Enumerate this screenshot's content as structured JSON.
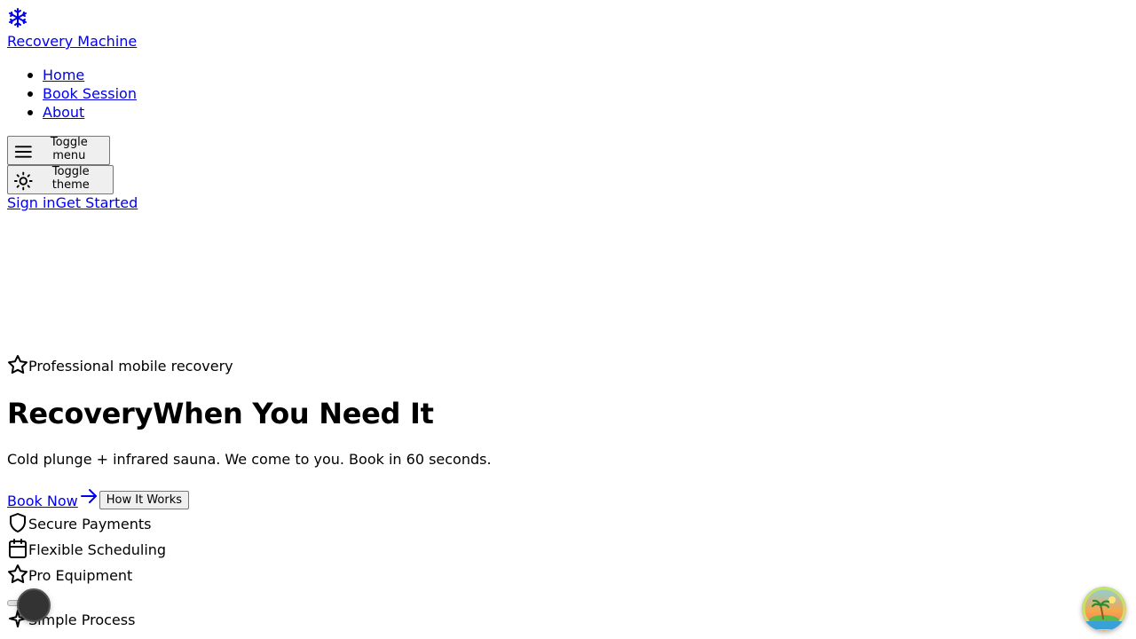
{
  "header": {
    "logo_icon": "snowflake-icon",
    "brand_label": "Recovery Machine",
    "nav": [
      {
        "label": "Home"
      },
      {
        "label": "Book Session"
      },
      {
        "label": "About"
      }
    ],
    "toggle_menu_label": "Toggle menu",
    "toggle_menu_icon": "menu-icon",
    "toggle_theme_label": "Toggle theme",
    "toggle_theme_icon": "sun-icon",
    "sign_in_label": "Sign in",
    "get_started_label": "Get Started"
  },
  "hero": {
    "badge_icon": "star-icon",
    "badge_label": "Professional mobile recovery",
    "title_part1": "Recovery",
    "title_part2": "When You Need It",
    "subtitle": "Cold plunge + infrared sauna. We come to you. Book in 60 seconds.",
    "primary_cta": "Book Now",
    "primary_cta_icon": "arrow-right-icon",
    "secondary_cta": "How It Works"
  },
  "features": [
    {
      "icon": "shield-icon",
      "label": "Secure Payments"
    },
    {
      "icon": "calendar-icon",
      "label": "Flexible Scheduling"
    },
    {
      "icon": "star-icon",
      "label": "Pro Equipment"
    },
    {
      "icon": "sparkle-icon",
      "label": "Simple Process"
    }
  ],
  "colors": {
    "link": "#0000ee",
    "text": "#000000",
    "background": "#ffffff",
    "button_bg": "#efefef",
    "floating_button": "#333333"
  }
}
